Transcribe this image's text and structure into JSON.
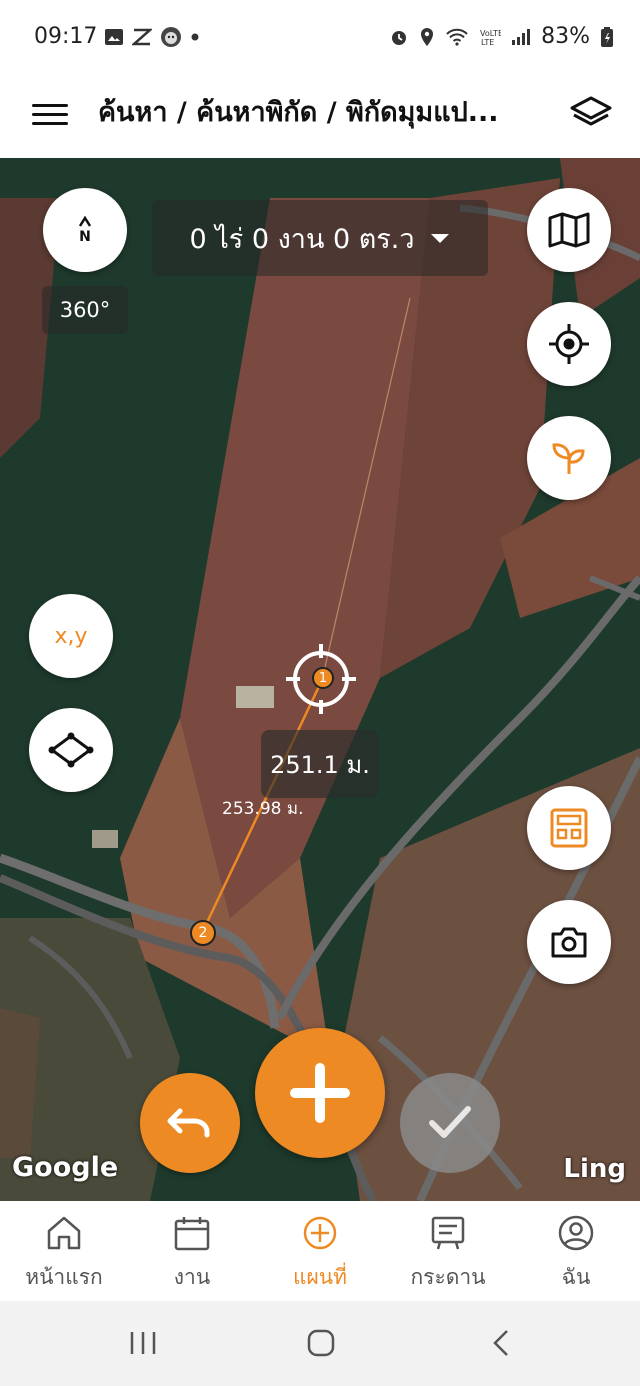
{
  "status": {
    "time": "09:17",
    "battery": "83%"
  },
  "header": {
    "breadcrumb": "ค้นหา / ค้นหาพิกัด / พิกัดมุมแป..."
  },
  "map": {
    "area_summary": "0 ไร่ 0 งาน 0 ตร.ว",
    "compass_letter": "N",
    "compass_angle": "360°",
    "coord_button_label": "x,y",
    "measured_distance": "251.1 ม.",
    "segment_length": "253.98 ม.",
    "point_1_label": "1",
    "point_2_label": "2",
    "attribution_google": "Google",
    "attribution_ling": "Ling"
  },
  "bottom_nav": [
    {
      "label": "หน้าแรก",
      "icon": "home-icon",
      "active": false
    },
    {
      "label": "งาน",
      "icon": "calendar-icon",
      "active": false
    },
    {
      "label": "แผนที่",
      "icon": "add-circle-icon",
      "active": true
    },
    {
      "label": "กระดาน",
      "icon": "board-icon",
      "active": false
    },
    {
      "label": "ฉัน",
      "icon": "profile-icon",
      "active": false
    }
  ],
  "colors": {
    "accent": "#ee8a23",
    "confirm_disabled": "#8a8a8a"
  }
}
